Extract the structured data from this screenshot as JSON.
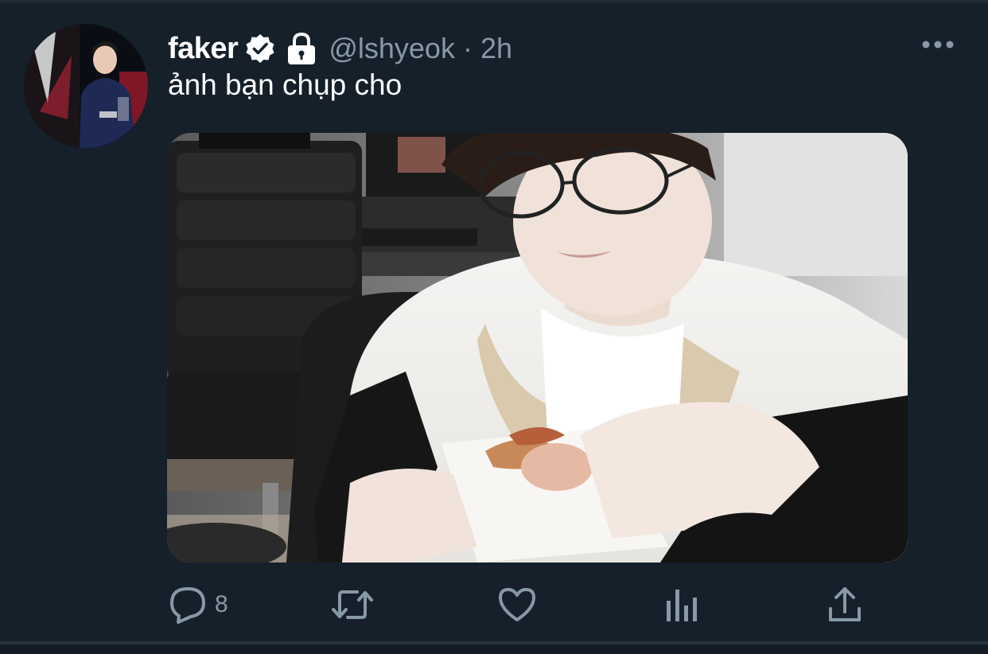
{
  "tweet": {
    "display_name": "faker",
    "handle": "@lshyeok",
    "separator": "·",
    "timestamp": "2h",
    "text": "ảnh bạn chụp cho",
    "verified": true,
    "protected": true,
    "media_alt": "photo"
  },
  "actions": {
    "reply_count": "8",
    "icons": [
      "reply-icon",
      "retweet-icon",
      "like-icon",
      "analytics-icon",
      "share-icon"
    ]
  },
  "colors": {
    "background": "#15202b",
    "secondary_text": "#8899a6",
    "primary_text": "#ffffff"
  }
}
